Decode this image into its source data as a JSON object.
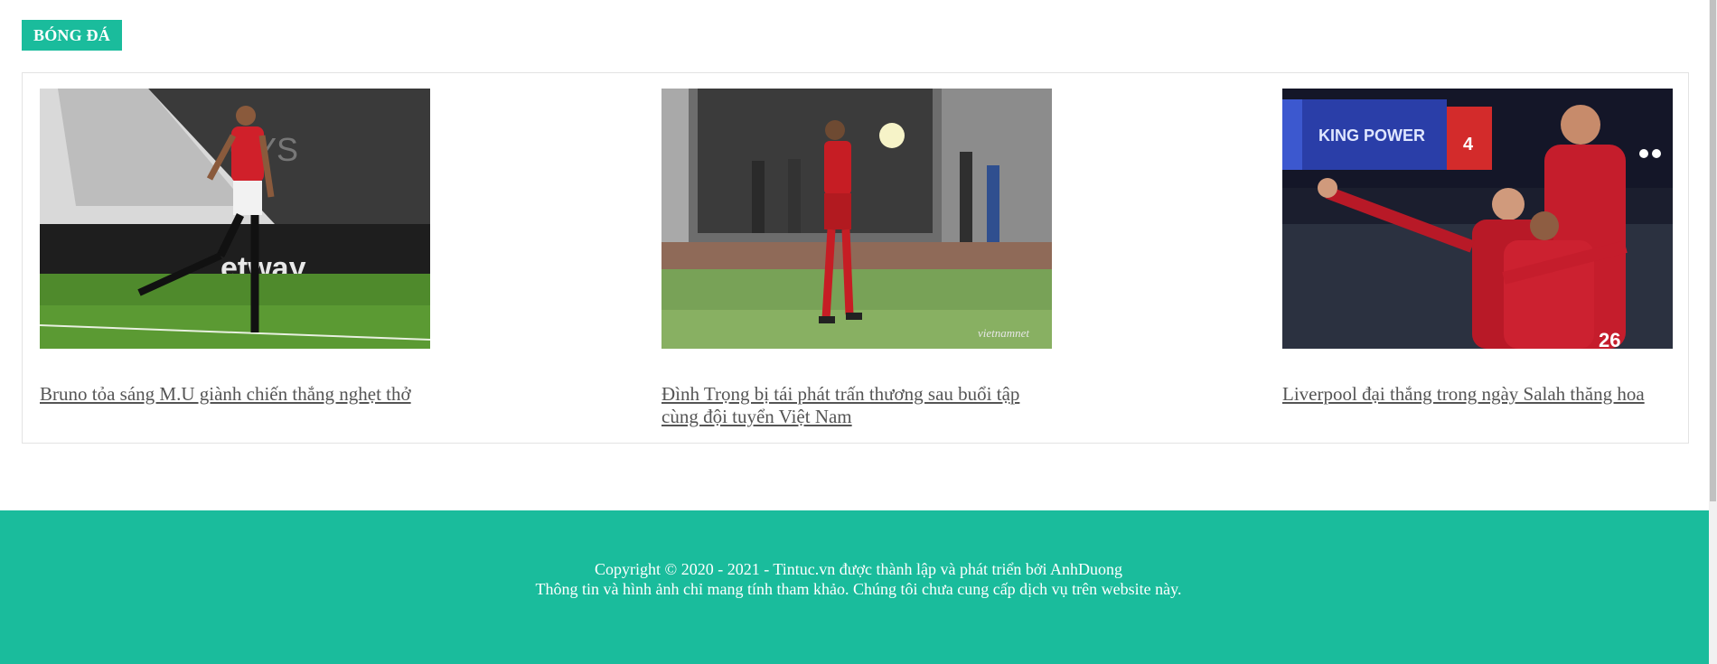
{
  "section": {
    "tag_label": "BÓNG ĐÁ"
  },
  "articles": [
    {
      "title": "Bruno tỏa sáng M.U giành chiến thắng nghẹt thở",
      "image": "football-player-celebrating-photo"
    },
    {
      "title": "Đình Trọng bị tái phát trấn thương sau buổi tập cùng đội tuyển Việt Nam",
      "image": "injured-player-walking-photo"
    },
    {
      "title": "Liverpool đại thắng trong ngày Salah thăng hoa",
      "image": "team-celebration-photo"
    }
  ],
  "footer": {
    "line1": "Copyright © 2020 - 2021 - Tintuc.vn được thành lập và phát triển bởi AnhDuong",
    "line2": "Thông tin và hình ảnh chỉ mang tính tham khảo. Chúng tôi chưa cung cấp dịch vụ trên website này."
  },
  "colors": {
    "accent": "#1abc9c",
    "link": "#555555",
    "border": "#e3e3e3"
  }
}
